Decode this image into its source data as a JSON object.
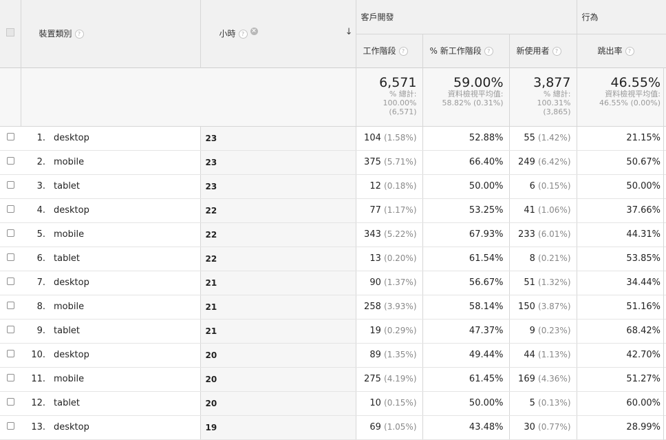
{
  "header": {
    "dim_col1": "裝置類別",
    "dim_col2": "小時",
    "group_acq": "客戶開發",
    "group_beh": "行為",
    "metrics": [
      "工作階段",
      "% 新工作階段",
      "新使用者",
      "跳出率"
    ]
  },
  "totals": [
    {
      "value": "6,571",
      "lines": [
        "% 總計:",
        "100.00%",
        "(6,571)"
      ]
    },
    {
      "value": "59.00%",
      "lines": [
        "資料檢視平均值:",
        "58.82% (0.31%)"
      ]
    },
    {
      "value": "3,877",
      "lines": [
        "% 總計:",
        "100.31%",
        "(3,865)"
      ]
    },
    {
      "value": "46.55%",
      "lines": [
        "資料檢視平均值:",
        "46.55% (0.00%)"
      ]
    }
  ],
  "rows": [
    {
      "idx": "1.",
      "device": "desktop",
      "hour": "23",
      "sessions": "104",
      "sessions_pct": "(1.58%)",
      "new_sessions": "52.88%",
      "new_users": "55",
      "new_users_pct": "(1.42%)",
      "bounce": "21.15%"
    },
    {
      "idx": "2.",
      "device": "mobile",
      "hour": "23",
      "sessions": "375",
      "sessions_pct": "(5.71%)",
      "new_sessions": "66.40%",
      "new_users": "249",
      "new_users_pct": "(6.42%)",
      "bounce": "50.67%"
    },
    {
      "idx": "3.",
      "device": "tablet",
      "hour": "23",
      "sessions": "12",
      "sessions_pct": "(0.18%)",
      "new_sessions": "50.00%",
      "new_users": "6",
      "new_users_pct": "(0.15%)",
      "bounce": "50.00%"
    },
    {
      "idx": "4.",
      "device": "desktop",
      "hour": "22",
      "sessions": "77",
      "sessions_pct": "(1.17%)",
      "new_sessions": "53.25%",
      "new_users": "41",
      "new_users_pct": "(1.06%)",
      "bounce": "37.66%"
    },
    {
      "idx": "5.",
      "device": "mobile",
      "hour": "22",
      "sessions": "343",
      "sessions_pct": "(5.22%)",
      "new_sessions": "67.93%",
      "new_users": "233",
      "new_users_pct": "(6.01%)",
      "bounce": "44.31%"
    },
    {
      "idx": "6.",
      "device": "tablet",
      "hour": "22",
      "sessions": "13",
      "sessions_pct": "(0.20%)",
      "new_sessions": "61.54%",
      "new_users": "8",
      "new_users_pct": "(0.21%)",
      "bounce": "53.85%"
    },
    {
      "idx": "7.",
      "device": "desktop",
      "hour": "21",
      "sessions": "90",
      "sessions_pct": "(1.37%)",
      "new_sessions": "56.67%",
      "new_users": "51",
      "new_users_pct": "(1.32%)",
      "bounce": "34.44%"
    },
    {
      "idx": "8.",
      "device": "mobile",
      "hour": "21",
      "sessions": "258",
      "sessions_pct": "(3.93%)",
      "new_sessions": "58.14%",
      "new_users": "150",
      "new_users_pct": "(3.87%)",
      "bounce": "51.16%"
    },
    {
      "idx": "9.",
      "device": "tablet",
      "hour": "21",
      "sessions": "19",
      "sessions_pct": "(0.29%)",
      "new_sessions": "47.37%",
      "new_users": "9",
      "new_users_pct": "(0.23%)",
      "bounce": "68.42%"
    },
    {
      "idx": "10.",
      "device": "desktop",
      "hour": "20",
      "sessions": "89",
      "sessions_pct": "(1.35%)",
      "new_sessions": "49.44%",
      "new_users": "44",
      "new_users_pct": "(1.13%)",
      "bounce": "42.70%"
    },
    {
      "idx": "11.",
      "device": "mobile",
      "hour": "20",
      "sessions": "275",
      "sessions_pct": "(4.19%)",
      "new_sessions": "61.45%",
      "new_users": "169",
      "new_users_pct": "(4.36%)",
      "bounce": "51.27%"
    },
    {
      "idx": "12.",
      "device": "tablet",
      "hour": "20",
      "sessions": "10",
      "sessions_pct": "(0.15%)",
      "new_sessions": "50.00%",
      "new_users": "5",
      "new_users_pct": "(0.13%)",
      "bounce": "60.00%"
    },
    {
      "idx": "13.",
      "device": "desktop",
      "hour": "19",
      "sessions": "69",
      "sessions_pct": "(1.05%)",
      "new_sessions": "43.48%",
      "new_users": "30",
      "new_users_pct": "(0.77%)",
      "bounce": "28.99%"
    }
  ],
  "icons": {
    "help": "help-question-icon",
    "remove": "remove-dimension-icon",
    "sort": "sort-descending-arrow-icon",
    "help_glyph": "?",
    "remove_glyph": "×",
    "sort_glyph": "↓"
  }
}
